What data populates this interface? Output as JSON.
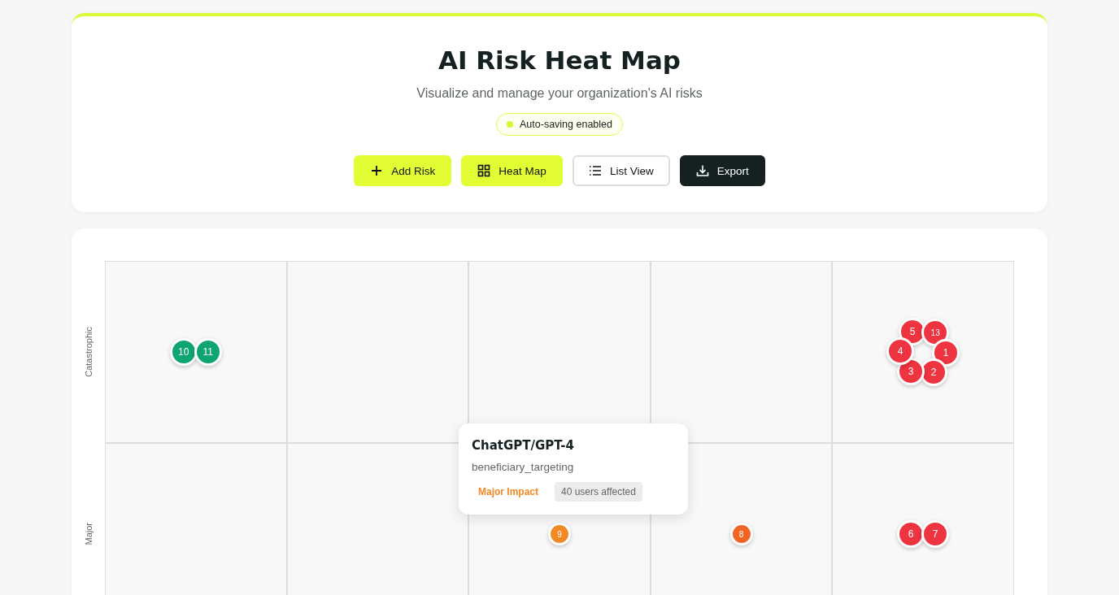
{
  "header": {
    "title": "AI Risk Heat Map",
    "subtitle": "Visualize and manage your organization's AI risks",
    "status": {
      "label": "Auto-saving enabled",
      "on": true
    }
  },
  "buttons": [
    {
      "kind": "add",
      "label": "Add Risk"
    },
    {
      "kind": "grid",
      "label": "Heat Map",
      "selected": true
    },
    {
      "kind": "list",
      "label": "List View",
      "selected": false
    },
    {
      "kind": "export",
      "label": "Export"
    }
  ],
  "heat_map": {
    "rows": [
      {
        "label": "Catastrophic",
        "cells": [
          {
            "markers": [
              {
                "number": "10",
                "color": "#0ea572"
              },
              {
                "number": "11",
                "color": "#0ea572"
              }
            ]
          },
          {},
          {},
          {},
          {
            "markers": [
              {
                "number": "5",
                "color": "#ee3440"
              },
              {
                "number": "13",
                "color": "#ee3440"
              },
              {
                "number": "1",
                "color": "#ee3440"
              },
              {
                "number": "2",
                "color": "#ee3440"
              },
              {
                "number": "3",
                "color": "#ee3440"
              },
              {
                "number": "4",
                "color": "#ee3440"
              }
            ]
          }
        ]
      },
      {
        "label": "Major",
        "cells": [
          {},
          {},
          {
            "markers": [
              {
                "number": "9",
                "color": "#f18a24",
                "tooltip": {
                  "title": "ChatGPT/GPT-4",
                  "category": "beneficiary_targeting",
                  "impact": "Major Impact",
                  "users": "40 users affected"
                }
              }
            ]
          },
          {
            "markers": [
              {
                "number": "8",
                "color": "#f26422"
              }
            ]
          },
          {
            "markers": [
              {
                "number": "6",
                "color": "#ee3440"
              },
              {
                "number": "7",
                "color": "#ee3440"
              }
            ]
          }
        ]
      }
    ]
  }
}
